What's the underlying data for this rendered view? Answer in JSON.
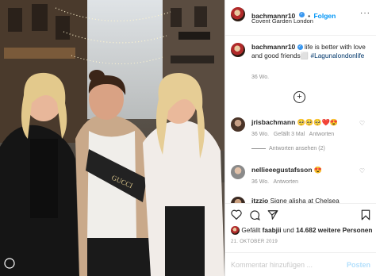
{
  "post": {
    "username": "bachmannr10",
    "verified_icon": "verified-badge-icon",
    "follow_label": "Folgen",
    "location": "Covent Garden London",
    "caption_username": "bachmannr10",
    "caption_text": "life is better with love and good friends⬜",
    "hashtag": "#Lagunalondonlife",
    "caption_time": "36 Wo.",
    "load_more_icon": "plus-circle-icon"
  },
  "photo": {
    "bag_text": "GUCCI",
    "corner_logo_icon": "instagram-logo-icon"
  },
  "comments": [
    {
      "username": "jrisbachmann",
      "text": "🥺🥺🥺❤️😍",
      "time": "36 Wo.",
      "likes": "Gefällt 3 Mal",
      "reply": "Antworten",
      "view_replies": "Antworten ansehen (2)"
    },
    {
      "username": "nellieeegustafsson",
      "text": "😍",
      "time": "36 Wo.",
      "reply": "Antworten"
    },
    {
      "username": "itzzio",
      "text": "Signe alisha at Chelsea",
      "time": "",
      "reply": ""
    }
  ],
  "actions": {
    "like_icon": "heart-icon",
    "comment_icon": "comment-icon",
    "share_icon": "send-icon",
    "save_icon": "bookmark-icon",
    "liked_prefix": "Gefällt",
    "liked_user": "faabjii",
    "liked_and": "und",
    "liked_count": "14.682 weitere Personen",
    "date": "21. OKTOBER 2019"
  },
  "comment_box": {
    "placeholder": "Kommentar hinzufügen ...",
    "post_label": "Posten"
  },
  "colors": {
    "accent": "#0095f6",
    "border": "#dbdbdb",
    "muted": "#8e8e8e"
  }
}
